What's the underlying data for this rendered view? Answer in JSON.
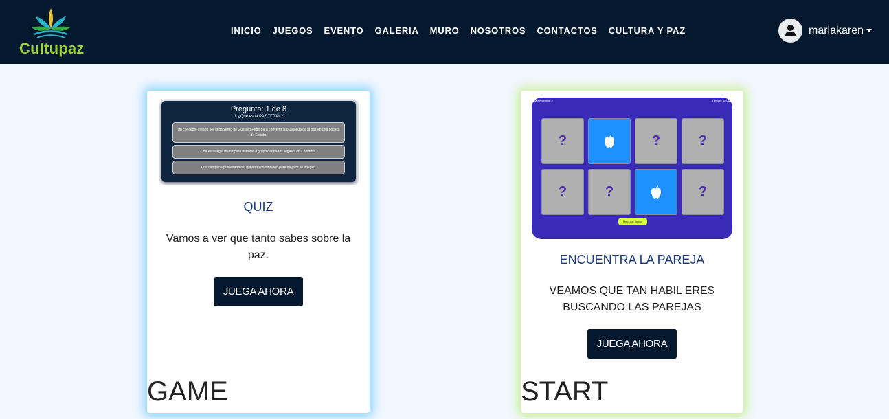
{
  "brand": {
    "name": "Cultupaz"
  },
  "nav": {
    "items": [
      {
        "label": "INICIO"
      },
      {
        "label": "JUEGOS"
      },
      {
        "label": "EVENTO"
      },
      {
        "label": "GALERIA"
      },
      {
        "label": "MURO"
      },
      {
        "label": "NOSOTROS"
      },
      {
        "label": "CONTACTOS"
      },
      {
        "label": "CULTURA Y PAZ"
      }
    ]
  },
  "user": {
    "name": "mariakaren"
  },
  "cards": [
    {
      "title": "QUIZ",
      "description": "Vamos a ver que tanto sabes sobre la paz.",
      "button": "JUEGA AHORA",
      "footer": "GAME",
      "thumb": {
        "header": "Pregunta: 1 de 8",
        "question": "1.¿Qué es la PAZ TOTAL?",
        "options": [
          "Un concepto creado por el gobierno de Gustavo Petro para convertir la búsqueda de la paz en una política de Estado.",
          "Una estrategia militar para derrotar a grupos armados ilegales en Colombia.",
          "Una campaña publicitaria del gobierno colombiano para mejorar su imagen."
        ]
      }
    },
    {
      "title": "ENCUENTRA LA PAREJA",
      "description": "VEAMOS QUE TAN HABIL ERES BUSCANDO LAS PAREJAS",
      "button": "JUEGA AHORA",
      "footer": "START",
      "thumb": {
        "moves": "Movimientos: 2",
        "time": "Tiempo: 00:05",
        "tiles": [
          "?",
          "",
          "?",
          "?",
          "?",
          "?",
          "",
          "?"
        ],
        "reset": "Reiniciar Juego"
      }
    }
  ],
  "colors": {
    "navbar": "#04182e",
    "brand_green": "#9bd33c",
    "button": "#04182e",
    "quiz_glow": "#64c8ff",
    "pair_glow": "#bef078",
    "memory_bg": "#3a2ab8"
  }
}
